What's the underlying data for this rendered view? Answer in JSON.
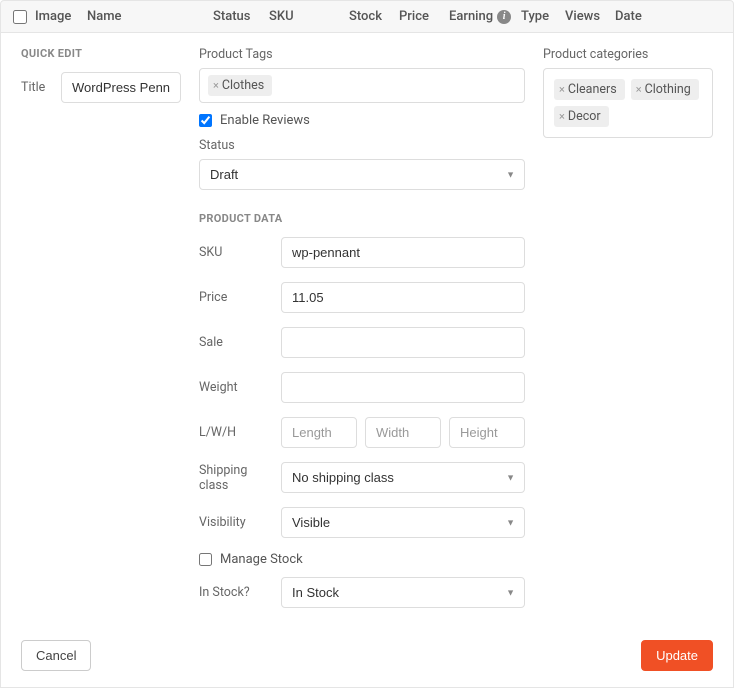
{
  "header": {
    "image": "Image",
    "name": "Name",
    "status": "Status",
    "sku": "SKU",
    "stock": "Stock",
    "price": "Price",
    "earning": "Earning",
    "type": "Type",
    "views": "Views",
    "date": "Date"
  },
  "quickEdit": {
    "label": "QUICK EDIT",
    "titleLabel": "Title",
    "titleValue": "WordPress Pennan"
  },
  "productTags": {
    "label": "Product Tags",
    "tags": [
      "Clothes"
    ]
  },
  "enableReviews": {
    "label": "Enable Reviews",
    "checked": true
  },
  "status": {
    "label": "Status",
    "value": "Draft"
  },
  "productData": {
    "label": "PRODUCT DATA",
    "skuLabel": "SKU",
    "skuValue": "wp-pennant",
    "priceLabel": "Price",
    "priceValue": "11.05",
    "saleLabel": "Sale",
    "saleValue": "",
    "weightLabel": "Weight",
    "weightValue": "",
    "dimLabel": "L/W/H",
    "lengthPh": "Length",
    "widthPh": "Width",
    "heightPh": "Height",
    "shippingLabel": "Shipping class",
    "shippingValue": "No shipping class",
    "visibilityLabel": "Visibility",
    "visibilityValue": "Visible",
    "manageStockLabel": "Manage Stock",
    "manageStockChecked": false,
    "inStockLabel": "In Stock?",
    "inStockValue": "In Stock"
  },
  "categories": {
    "label": "Product categories",
    "items": [
      "Cleaners",
      "Clothing",
      "Decor"
    ]
  },
  "footer": {
    "cancel": "Cancel",
    "update": "Update"
  }
}
